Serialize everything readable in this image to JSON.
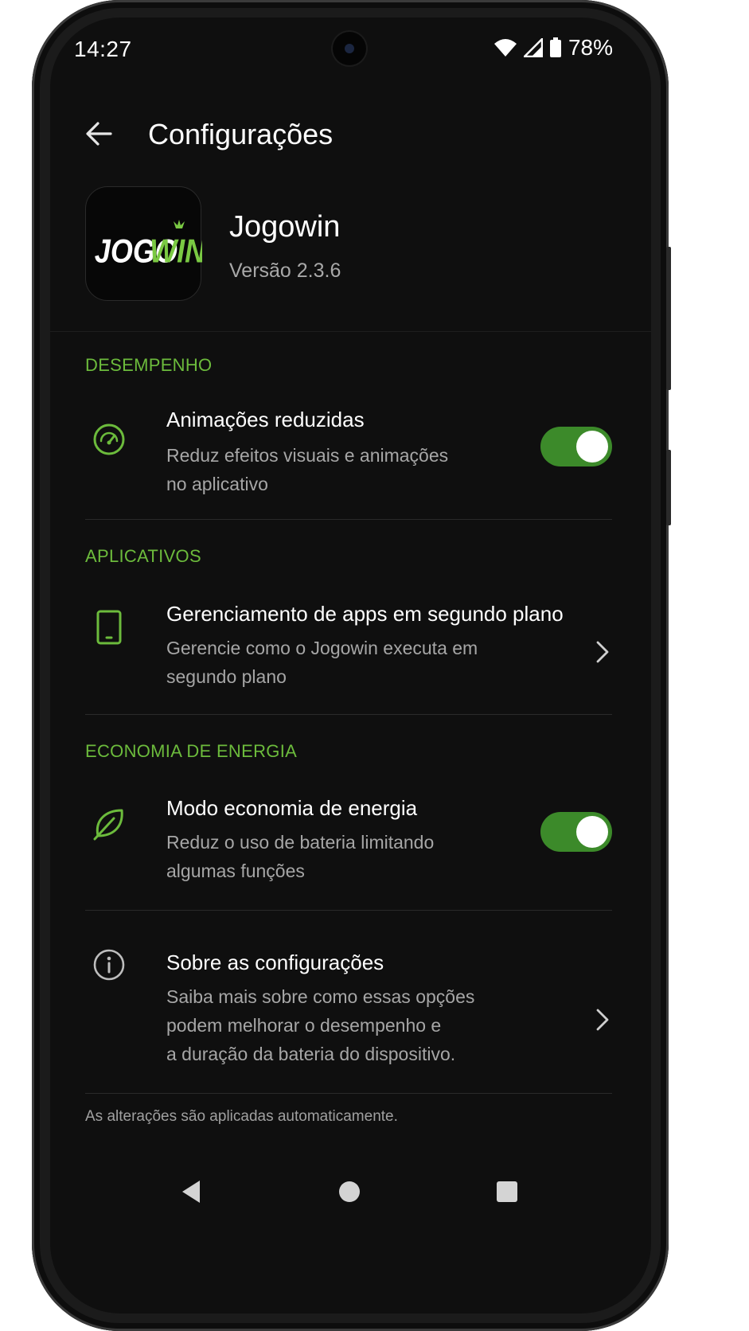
{
  "status_bar": {
    "time": "14:27",
    "battery_percent": "78%",
    "icons": [
      "wifi-icon",
      "cell-signal-icon",
      "battery-icon"
    ]
  },
  "appbar": {
    "back_icon": "arrow-left-icon",
    "title": "Configurações"
  },
  "app": {
    "logo_text_white": "JOGO",
    "logo_text_green": "WIN",
    "name": "Jogowin",
    "version": "Versão 2.3.6"
  },
  "sections": {
    "performance": {
      "label": "DESEMPENHO",
      "item": {
        "icon": "speedometer-icon",
        "title": "Animações reduzidas",
        "desc_line1": "Reduz efeitos visuais e animações",
        "desc_line2": "no aplicativo",
        "toggle_on": true
      }
    },
    "apps": {
      "label": "APLICATIVOS",
      "item": {
        "icon": "phone-icon",
        "title": "Gerenciamento de apps em segundo plano",
        "desc_line1": "Gerencie como o Jogowin executa em",
        "desc_line2": "segundo plano"
      }
    },
    "energy": {
      "label": "ECONOMIA DE ENERGIA",
      "item": {
        "icon": "leaf-icon",
        "title": "Modo economia de energia",
        "desc_line1": "Reduz o uso de bateria limitando",
        "desc_line2": "algumas funções",
        "toggle_on": true
      }
    },
    "about": {
      "item": {
        "icon": "info-icon",
        "title": "Sobre as configurações",
        "desc_line1": "Saiba mais sobre como essas opções",
        "desc_line2": "podem melhorar o desempenho e",
        "desc_line3": "a duração da bateria do dispositivo."
      }
    }
  },
  "footnote": "As alterações são aplicadas automaticamente.",
  "nav": {
    "back": "nav-back-icon",
    "home": "nav-home-icon",
    "recents": "nav-recents-icon"
  },
  "colors": {
    "accent": "#6cbb3c",
    "toggle_on": "#3c8a2a",
    "background": "#0f0f0f"
  }
}
